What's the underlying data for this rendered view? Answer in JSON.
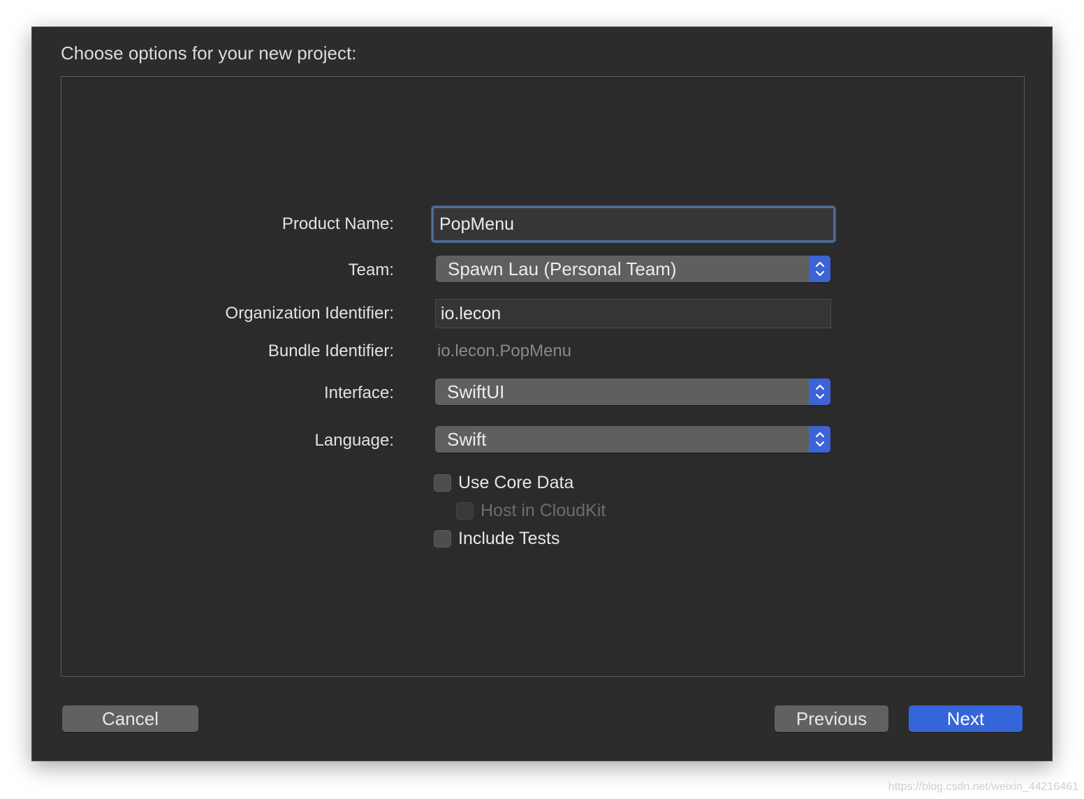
{
  "dialog": {
    "title": "Choose options for your new project:"
  },
  "form": {
    "product_name": {
      "label": "Product Name:",
      "value": "PopMenu"
    },
    "team": {
      "label": "Team:",
      "value": "Spawn Lau (Personal Team)"
    },
    "organization_identifier": {
      "label": "Organization Identifier:",
      "value": "io.lecon"
    },
    "bundle_identifier": {
      "label": "Bundle Identifier:",
      "value": "io.lecon.PopMenu"
    },
    "interface": {
      "label": "Interface:",
      "value": "SwiftUI"
    },
    "language": {
      "label": "Language:",
      "value": "Swift"
    },
    "options": [
      {
        "label": "Use Core Data",
        "checked": false,
        "enabled": true
      },
      {
        "label": "Host in CloudKit",
        "checked": false,
        "enabled": false
      },
      {
        "label": "Include Tests",
        "checked": false,
        "enabled": true
      }
    ]
  },
  "buttons": {
    "cancel": "Cancel",
    "previous": "Previous",
    "next": "Next"
  },
  "icons": {
    "popup": "chevron-up-down-icon"
  },
  "colors": {
    "accent": "#3566d9",
    "focus_ring": "#4d6e9b",
    "background": "#2c2c2c"
  },
  "watermark": "https://blog.csdn.net/weixin_44216461"
}
